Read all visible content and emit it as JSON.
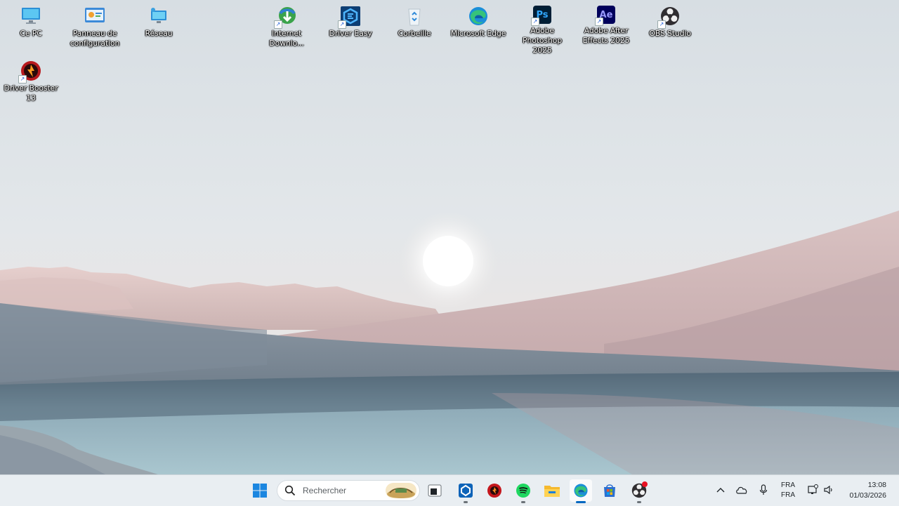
{
  "desktop": {
    "icons": [
      {
        "label": "Ce PC",
        "icon": "computer-icon"
      },
      {
        "label": "Panneau de configuration",
        "icon": "control-panel-icon"
      },
      {
        "label": "Réseau",
        "icon": "network-icon"
      },
      {
        "label": "Internet Downlo...",
        "icon": "internet-download-manager-icon"
      },
      {
        "label": "Driver Easy",
        "icon": "driver-easy-icon"
      },
      {
        "label": "Corbeille",
        "icon": "recycle-bin-icon"
      },
      {
        "label": "Microsoft Edge",
        "icon": "edge-icon"
      },
      {
        "label": "Adobe Photoshop 2025",
        "icon": "photoshop-icon"
      },
      {
        "label": "Adobe After Effects 2025",
        "icon": "after-effects-icon"
      },
      {
        "label": "OBS Studio",
        "icon": "obs-icon"
      },
      {
        "label": "Driver Booster 13",
        "icon": "driver-booster-icon"
      }
    ],
    "ps_text": "Ps",
    "ae_text": "Ae"
  },
  "taskbar": {
    "search_placeholder": "Rechercher",
    "apps": [
      "start-icon",
      "terminal-icon",
      "driver-easy-icon",
      "app-red-icon",
      "spotify-icon",
      "file-explorer-icon",
      "edge-icon",
      "store-icon",
      "obs-icon"
    ],
    "tray": {
      "lang_top": "FRA",
      "lang_bottom": "FRA",
      "time": "13:08",
      "date": "01/03/2026"
    }
  },
  "colors": {
    "accent": "#0067c0",
    "spotify": "#1ed760",
    "photoshop": "#31a8ff",
    "after_effects": "#9999ff",
    "taskbar_bg": "#e9eef2"
  }
}
